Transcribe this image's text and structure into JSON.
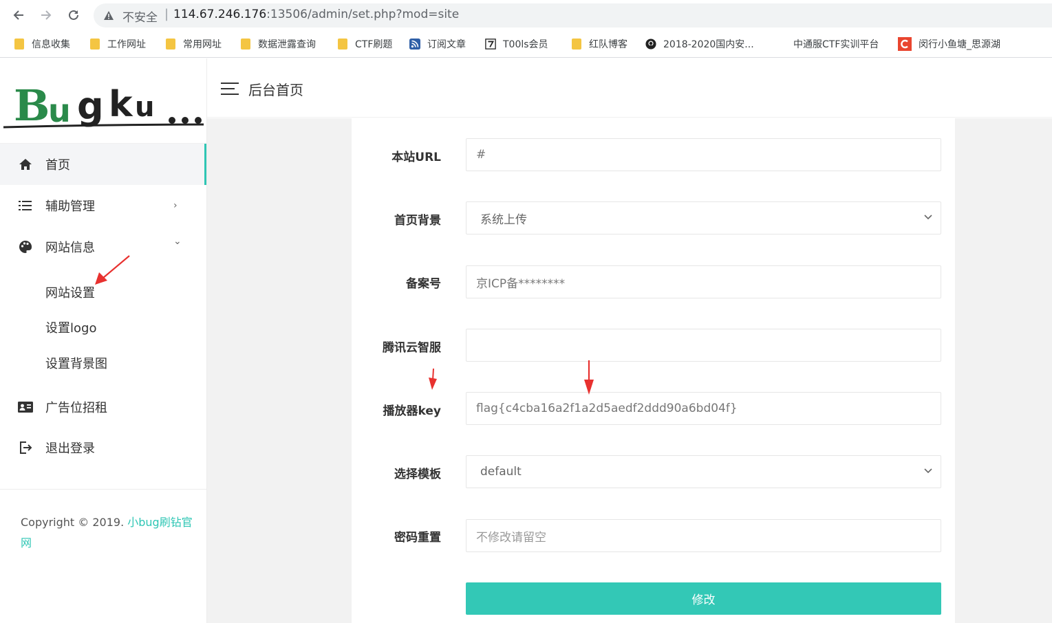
{
  "browser": {
    "insecure_label": "不安全",
    "url_host": "114.67.246.176",
    "url_rest": ":13506/admin/set.php?mod=site"
  },
  "bookmarks": [
    {
      "label": "信息收集",
      "icon": "folder-icon"
    },
    {
      "label": "工作网址",
      "icon": "folder-icon"
    },
    {
      "label": "常用网址",
      "icon": "folder-icon"
    },
    {
      "label": "数据泄露查询",
      "icon": "folder-icon"
    },
    {
      "label": "CTF刷题",
      "icon": "folder-icon"
    },
    {
      "label": "订阅文章",
      "icon": "rss-icon"
    },
    {
      "label": "T00ls会员",
      "icon": "t00ls-icon"
    },
    {
      "label": "红队博客",
      "icon": "folder-icon"
    },
    {
      "label": "2018-2020国内安...",
      "icon": "github-icon"
    },
    {
      "label": "中通服CTF实训平台",
      "icon": ""
    },
    {
      "label": "闵行小鱼塘_思源湖",
      "icon": "c-logo-icon"
    }
  ],
  "sidebar": {
    "logo_text": "Bugku...",
    "items": [
      {
        "label": "首页",
        "icon": "home-icon"
      },
      {
        "label": "辅助管理",
        "icon": "list-icon",
        "arrow": "›"
      },
      {
        "label": "网站信息",
        "icon": "palette-icon",
        "arrow": "⌄"
      },
      {
        "label": "广告位招租",
        "icon": "id-card-icon"
      },
      {
        "label": "退出登录",
        "icon": "logout-icon"
      }
    ],
    "sub_items": [
      "网站设置",
      "设置logo",
      "设置背景图"
    ],
    "copyright_prefix": "Copyright © 2019. ",
    "copyright_link": "小bug刷钻官网"
  },
  "header": {
    "title": "后台首页"
  },
  "form": {
    "fields": [
      {
        "label": "本站URL",
        "value": "#",
        "type": "text"
      },
      {
        "label": "首页背景",
        "value": "系统上传",
        "type": "select"
      },
      {
        "label": "备案号",
        "value": "京ICP备********",
        "type": "text"
      },
      {
        "label": "腾讯云智服",
        "value": "",
        "type": "text"
      },
      {
        "label": "播放器key",
        "value": "flag{c4cba16a2f1a2d5aedf2ddd90a6bd04f}",
        "type": "text"
      },
      {
        "label": "选择模板",
        "value": "default",
        "type": "select"
      },
      {
        "label": "密码重置",
        "value": "",
        "placeholder": "不修改请留空",
        "type": "text"
      }
    ],
    "submit_label": "修改"
  },
  "colors": {
    "accent": "#33c8b6",
    "annotation": "#e8312f"
  }
}
